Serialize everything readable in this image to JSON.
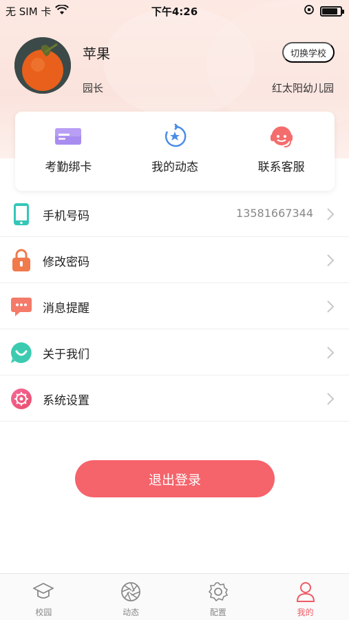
{
  "status_bar": {
    "carrier": "无 SIM 卡",
    "time": "下午4:26"
  },
  "profile": {
    "name": "苹果",
    "role": "园长",
    "school": "红太阳幼儿园",
    "switch_school_label": "切换学校"
  },
  "quick_actions": [
    {
      "label": "考勤绑卡",
      "icon": "card-icon"
    },
    {
      "label": "我的动态",
      "icon": "star-refresh-icon"
    },
    {
      "label": "联系客服",
      "icon": "headset-icon"
    }
  ],
  "menu": [
    {
      "label": "手机号码",
      "value": "13581667344",
      "icon": "phone-icon"
    },
    {
      "label": "修改密码",
      "value": "",
      "icon": "lock-icon"
    },
    {
      "label": "消息提醒",
      "value": "",
      "icon": "message-icon"
    },
    {
      "label": "关于我们",
      "value": "",
      "icon": "smile-icon"
    },
    {
      "label": "系统设置",
      "value": "",
      "icon": "settings-icon"
    }
  ],
  "logout_label": "退出登录",
  "tabs": [
    {
      "label": "校园",
      "icon": "school-icon",
      "active": false
    },
    {
      "label": "动态",
      "icon": "aperture-icon",
      "active": false
    },
    {
      "label": "配置",
      "icon": "gear-icon",
      "active": false
    },
    {
      "label": "我的",
      "icon": "person-icon",
      "active": true
    }
  ],
  "colors": {
    "accent": "#f5636b",
    "active_tab": "#f05a64",
    "hero_bg": "#fde9e3"
  }
}
